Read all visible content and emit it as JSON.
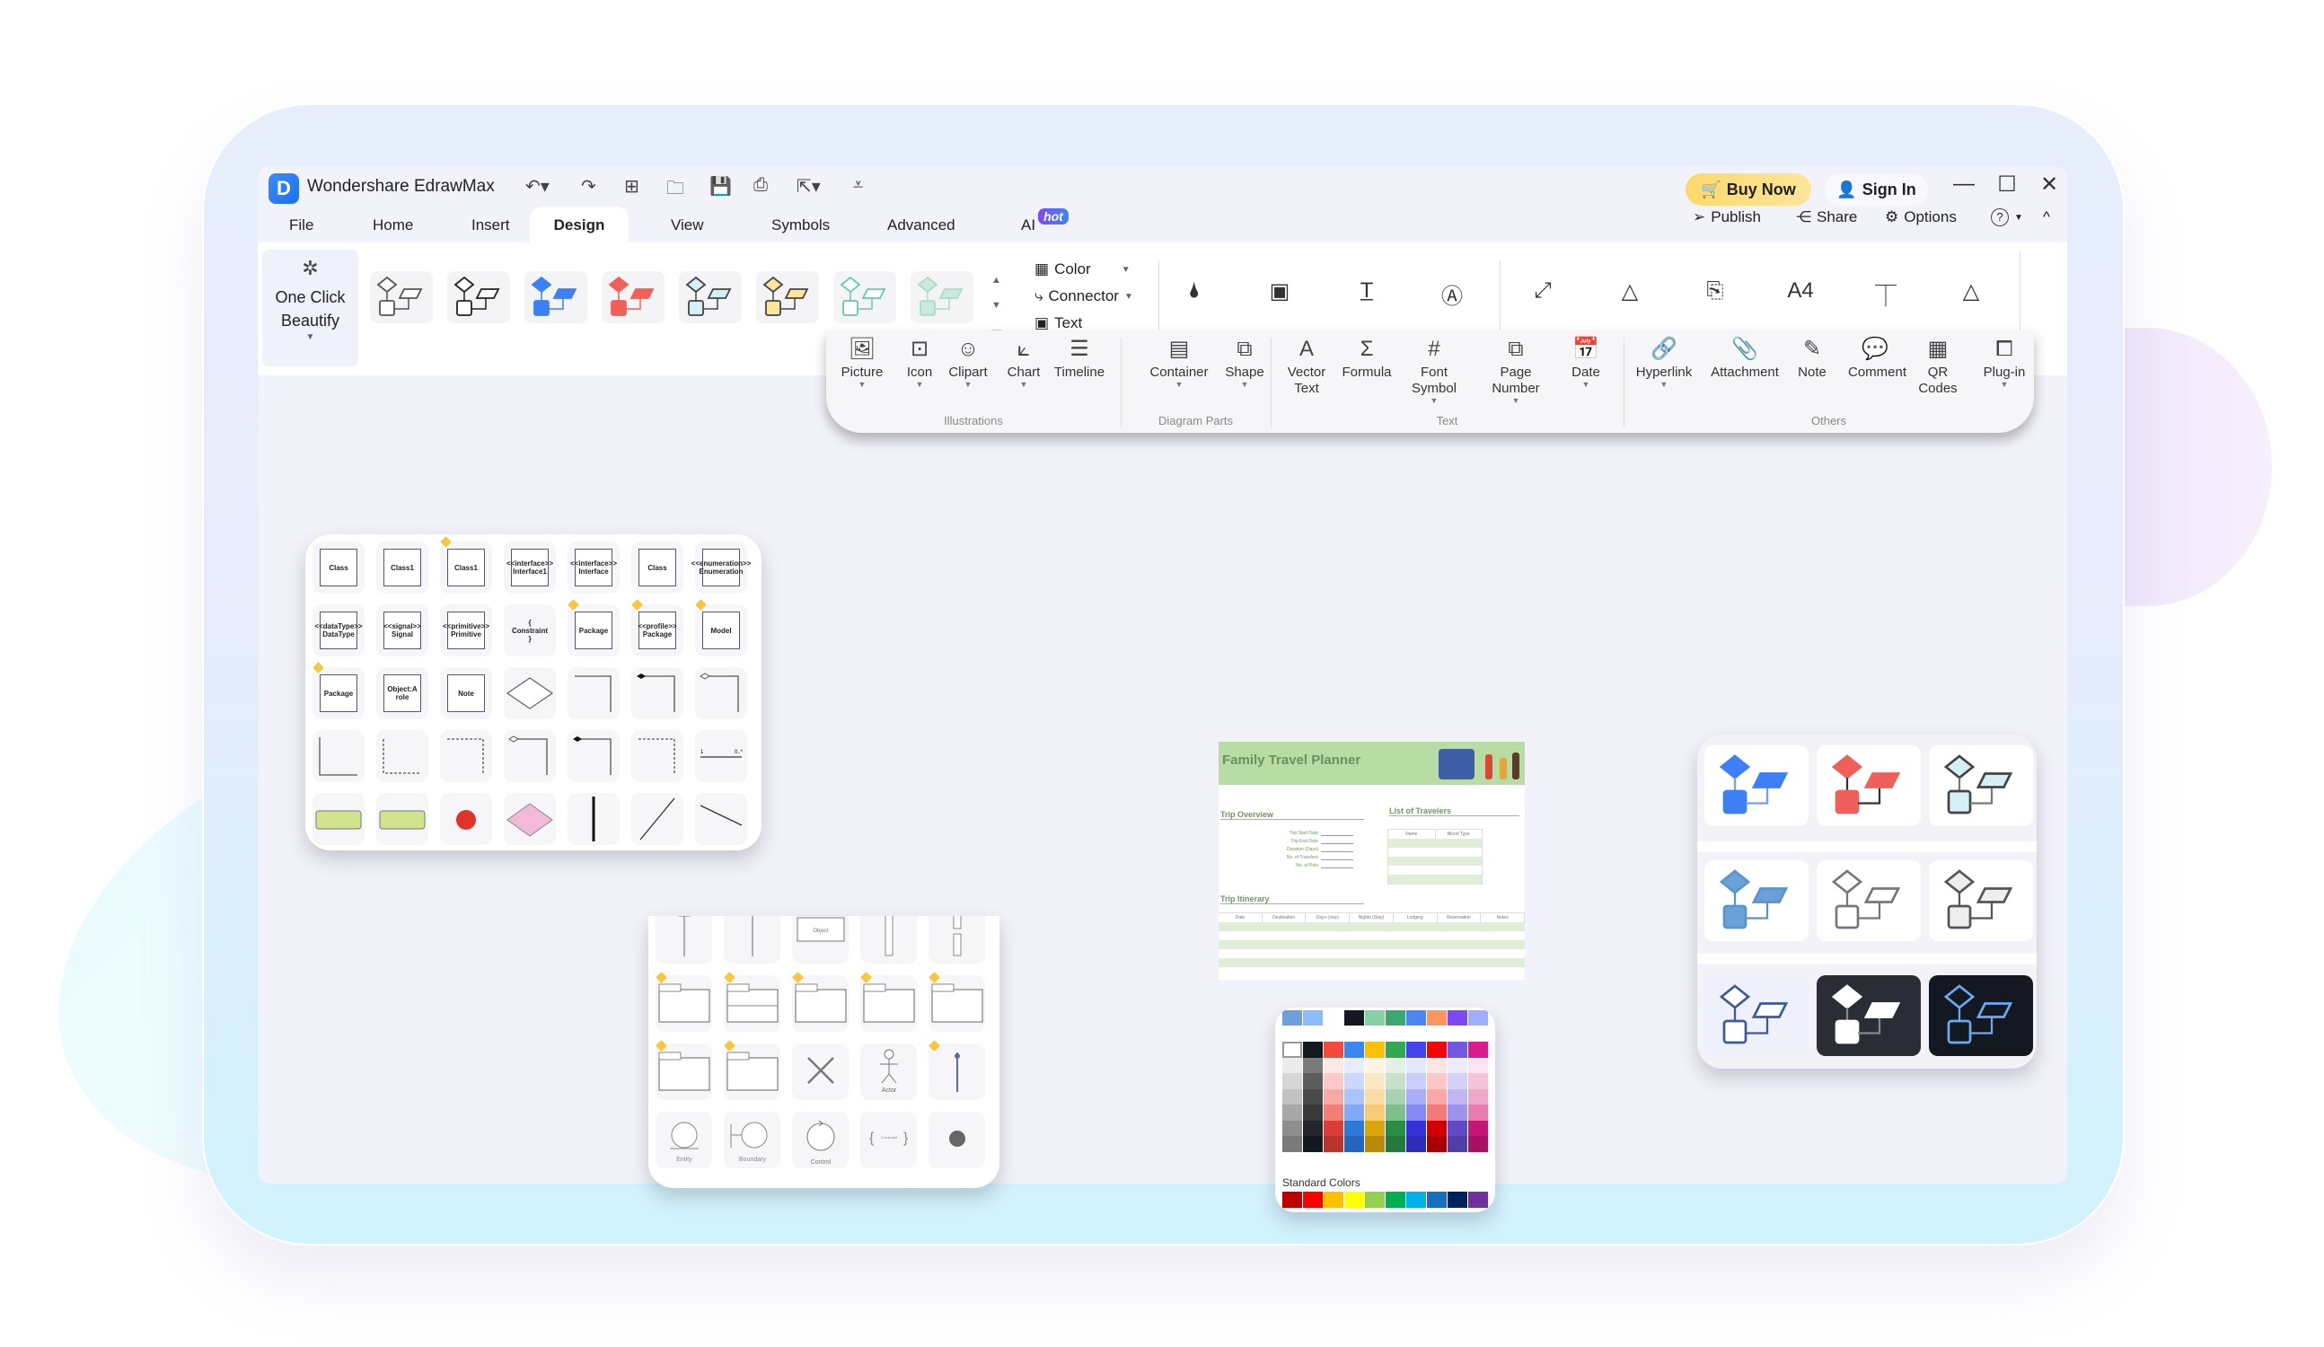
{
  "app": {
    "title": "Wondershare EdrawMax",
    "logo_glyph": "D",
    "quick_access": [
      "undo-icon",
      "redo-icon",
      "new-icon",
      "open-icon",
      "save-icon",
      "print-icon",
      "export-icon",
      "customize-icon"
    ],
    "quick_glyphs": [
      "↶▾",
      "↷",
      "⊞",
      "🗀",
      "💾",
      "⎙",
      "⇱▾",
      "⩡"
    ],
    "buy_now": "Buy Now",
    "sign_in": "Sign In",
    "window_glyphs": [
      "—",
      "☐",
      "✕"
    ]
  },
  "tabs": [
    {
      "label": "File"
    },
    {
      "label": "Home"
    },
    {
      "label": "Insert"
    },
    {
      "label": "Design",
      "active": true
    },
    {
      "label": "View"
    },
    {
      "label": "Symbols"
    },
    {
      "label": "Advanced"
    },
    {
      "label": "AI",
      "badge": "hot"
    }
  ],
  "toolbar_right": {
    "publish": "Publish",
    "share": "Share",
    "options": "Options",
    "help_glyph": "?",
    "collapse_glyph": "^"
  },
  "ribbon": {
    "one_click_beautify": "One Click Beautify",
    "themes": [
      {
        "name": "theme-outline",
        "fill": "#ffffff",
        "stroke": "#555555"
      },
      {
        "name": "theme-dark-outline",
        "fill": "#ffffff",
        "stroke": "#222222"
      },
      {
        "name": "theme-blue",
        "fill": "#3d7ff5",
        "stroke": "#3d7ff5"
      },
      {
        "name": "theme-red",
        "fill": "#f0605a",
        "stroke": "#f0605a"
      },
      {
        "name": "theme-cyan",
        "fill": "#d4eff5",
        "stroke": "#444444"
      },
      {
        "name": "theme-yellow",
        "fill": "#fbe69a",
        "stroke": "#444444"
      },
      {
        "name": "theme-mint-outline",
        "fill": "#ffffff",
        "stroke": "#66c9a7"
      },
      {
        "name": "theme-mint",
        "fill": "#cce9de",
        "stroke": "#a9dcc9"
      }
    ],
    "side_options": [
      {
        "label": "Color",
        "icon": "color-grid-icon"
      },
      {
        "label": "Connector",
        "icon": "connector-icon"
      },
      {
        "label": "Text",
        "icon": "text-icon"
      }
    ],
    "page_icons": [
      "background-color-icon",
      "background-picture-icon",
      "title-text-icon",
      "watermark-icon",
      "auto-size-icon",
      "borders-icon",
      "orientation-icon",
      "page-size-icon",
      "jump-style-icon",
      "triangle-icon"
    ],
    "page_glyphs": [
      "🌢",
      "▣",
      "T̲",
      "Ⓐ",
      "⤢",
      "△",
      "⎘",
      "A4",
      "⏉",
      "△"
    ]
  },
  "insert_panel": {
    "groups": [
      {
        "label": "Illustrations",
        "items": [
          {
            "label": "Picture",
            "glyph": "🖼",
            "dd": true
          },
          {
            "label": "Icon",
            "glyph": "⊡",
            "dd": true
          },
          {
            "label": "Clipart",
            "glyph": "☺",
            "dd": true
          },
          {
            "label": "Chart",
            "glyph": "⟀",
            "dd": true
          },
          {
            "label": "Timeline",
            "glyph": "☰",
            "dd": false
          }
        ]
      },
      {
        "label": "Diagram Parts",
        "items": [
          {
            "label": "Container",
            "glyph": "▤",
            "dd": true
          },
          {
            "label": "Shape",
            "glyph": "⧉",
            "dd": true
          }
        ]
      },
      {
        "label": "Text",
        "items": [
          {
            "label": "Vector Text",
            "glyph": "A",
            "dd": false
          },
          {
            "label": "Formula",
            "glyph": "Σ",
            "dd": false
          },
          {
            "label": "Font Symbol",
            "glyph": "#",
            "dd": true
          },
          {
            "label": "Page Number",
            "glyph": "⧉",
            "dd": true
          },
          {
            "label": "Date",
            "glyph": "📅",
            "dd": true
          }
        ]
      },
      {
        "label": "Others",
        "items": [
          {
            "label": "Hyperlink",
            "glyph": "🔗",
            "dd": true
          },
          {
            "label": "Attachment",
            "glyph": "📎",
            "dd": false
          },
          {
            "label": "Note",
            "glyph": "✎",
            "dd": false
          },
          {
            "label": "Comment",
            "glyph": "💬",
            "dd": false
          },
          {
            "label": "QR Codes",
            "glyph": "▦",
            "dd": false
          },
          {
            "label": "Plug-in",
            "glyph": "⧠",
            "dd": true
          }
        ]
      }
    ]
  },
  "uml_panel_1": {
    "rows": [
      [
        {
          "t": "Class"
        },
        {
          "t": "Class1"
        },
        {
          "t": "Class1",
          "pin": true
        },
        {
          "t": "<<interface>> Interface1"
        },
        {
          "t": "<<interface>> Interface"
        },
        {
          "t": "Class"
        },
        {
          "t": "<<enumeration>> Enumeration"
        }
      ],
      [
        {
          "t": "<<dataType>> DataType"
        },
        {
          "t": "<<signal>> Signal"
        },
        {
          "t": "<<primitive>> Primitive"
        },
        {
          "t": "{ Constraint }"
        },
        {
          "t": "Package",
          "pin": true
        },
        {
          "t": "<<profile>> Package",
          "pin": true
        },
        {
          "t": "Model",
          "pin": true
        }
      ],
      [
        {
          "t": "Package",
          "pin": true
        },
        {
          "t": "Object:A role"
        },
        {
          "t": "Note"
        },
        {
          "t": "diamond"
        },
        {
          "t": "arrow-generalization"
        },
        {
          "t": "arrow-composition"
        },
        {
          "t": "arrow-aggregation"
        }
      ],
      [
        {
          "t": "line-elbow"
        },
        {
          "t": "dashed-arrow"
        },
        {
          "t": "dashed-generalization"
        },
        {
          "t": "aggregation-line"
        },
        {
          "t": "composition-line"
        },
        {
          "t": "dashed-down-arrow"
        },
        {
          "t": "1 0..*"
        }
      ],
      [
        {
          "t": "state-green"
        },
        {
          "t": "state-green-2"
        },
        {
          "t": "initial-state"
        },
        {
          "t": "decision-pink"
        },
        {
          "t": "fork-bar"
        },
        {
          "t": "transition-line"
        },
        {
          "t": "arrow-line"
        }
      ]
    ]
  },
  "uml_panel_2": {
    "rows": [
      [
        "lifeline-object",
        "lifeline",
        "Object",
        "activation",
        "activation-break"
      ],
      [
        "package",
        "package-2",
        "frame",
        "frame-2",
        "frame-3"
      ],
      [
        "frame-4",
        "frame-5",
        "destroy",
        "Actor",
        "actor-lifeline"
      ],
      [
        "Entity",
        "Boundary",
        "Control",
        "Constraint",
        "final-node"
      ]
    ]
  },
  "travel_planner": {
    "title": "Family Travel Planner",
    "trip_overview": "Trip Overview",
    "overview_fields": [
      "Trip Start Date",
      "Trip End Date",
      "Duration (Days)",
      "No. of Travelers",
      "No. of Pets"
    ],
    "travelers_title": "List of Travelers",
    "travelers_cols": [
      "Name",
      "Blood Type"
    ],
    "itinerary_title": "Trip Itinerary",
    "itinerary_cols": [
      "Date",
      "Destination",
      "Days (stay)",
      "Nights (Stay)",
      "Lodging",
      "Reservation",
      "Notes"
    ]
  },
  "color_panel": {
    "top_row": [
      "#6d9fdb",
      "#8bbcfa",
      "#ffffff",
      "#141820",
      "#87d0a6",
      "#3aa96f",
      "#4a87f4",
      "#fb9660",
      "#7a4af5",
      "#9eaefc"
    ],
    "theme_grid": [
      [
        "#ffffff",
        "#141820",
        "#f44a3e",
        "#3b86f2",
        "#fbc10a",
        "#32a853",
        "#4444ee",
        "#f30606",
        "#7356e2",
        "#d81b8d"
      ],
      [
        "#ebebeb",
        "#7a7a7a",
        "#fde8e6",
        "#e4ecfd",
        "#fdf5e3",
        "#e3f0e6",
        "#e5e7fb",
        "#fde5e5",
        "#ecebfb",
        "#fbe4ee"
      ],
      [
        "#d6d6d6",
        "#5d5d5d",
        "#fbcac7",
        "#cad9fb",
        "#fbe8c3",
        "#c7e2cc",
        "#cbcdfa",
        "#fbc8c8",
        "#d6d2f7",
        "#f4c2da"
      ],
      [
        "#c2c2c2",
        "#4a4a4a",
        "#f8a9a5",
        "#aac5f9",
        "#f9dba6",
        "#a7d3b1",
        "#a9aef7",
        "#f9a8a8",
        "#bfb7f2",
        "#eea8c8"
      ],
      [
        "#a8a8a8",
        "#383838",
        "#f27e78",
        "#82a9f5",
        "#f6cb78",
        "#7fbf8c",
        "#8589f3",
        "#f47979",
        "#9f92ea",
        "#e87ab0"
      ],
      [
        "#8e8e8e",
        "#25262d",
        "#d83e35",
        "#2e78d8",
        "#dba60c",
        "#2a8c45",
        "#3431d8",
        "#d30000",
        "#6149c8",
        "#c41679"
      ],
      [
        "#7a7a7a",
        "#141820",
        "#b8342c",
        "#2365c0",
        "#ba8b0a",
        "#237a3b",
        "#2e2cb8",
        "#ac0000",
        "#523ea8",
        "#a81066"
      ]
    ],
    "standard_label": "Standard Colors",
    "standard": [
      "#c00000",
      "#ff0000",
      "#ffc000",
      "#ffff00",
      "#92d050",
      "#00b050",
      "#00b0f0",
      "#1a6cbd",
      "#002060",
      "#7030a0"
    ]
  },
  "theme_panel": {
    "rows": [
      [
        {
          "bg": "#ffffff",
          "fill": "#3d7ff5",
          "stroke": "#3d7ff5",
          "line": "#6fa0f7"
        },
        {
          "bg": "#ffffff",
          "fill": "#f0605a",
          "stroke": "#f0605a",
          "line": "#333333"
        },
        {
          "bg": "#ffffff",
          "fill": "#d4eff5",
          "stroke": "#444444",
          "line": "#777777"
        }
      ],
      [
        {
          "bg": "#ffffff",
          "fill": "#6aa1d8",
          "stroke": "#5b93cc",
          "line": "#5b93cc"
        },
        {
          "bg": "#ffffff",
          "fill": "#ffffff",
          "stroke": "#777777",
          "line": "#777777"
        },
        {
          "bg": "#ffffff",
          "fill": "#eeeeee",
          "stroke": "#555555",
          "line": "#555555"
        }
      ],
      [
        {
          "bg": "#eef0fa",
          "fill": "#ffffff",
          "stroke": "#3a5a9a",
          "line": "#3a5a9a"
        },
        {
          "bg": "#2a2d36",
          "fill": "#ffffff",
          "stroke": "#ffffff",
          "line": "#888888"
        },
        {
          "bg": "#141820",
          "fill": "#141820",
          "stroke": "#6aaaf0",
          "line": "#6aaaf0"
        }
      ]
    ]
  }
}
